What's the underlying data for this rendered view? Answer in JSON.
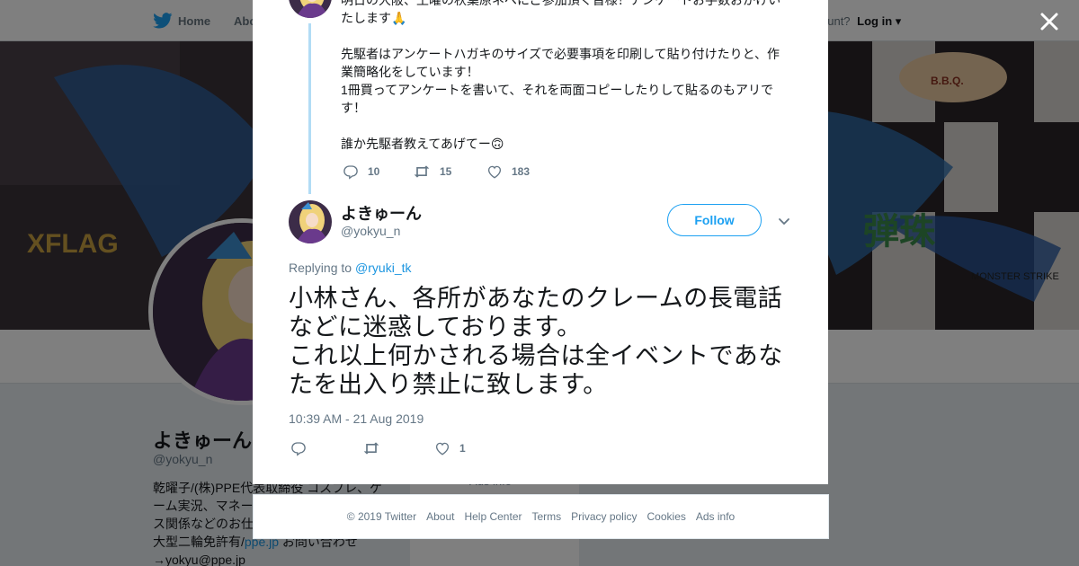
{
  "nav": {
    "home_label": "Home",
    "about_label": "Abo",
    "account_prompt": "ccount?",
    "login_label": "Log in"
  },
  "profile": {
    "name": "よきゅーん",
    "handle": "@yokyu_n",
    "bio_line1": "乾曜子/(株)PPE代表取締役 コスプレ、ゲ",
    "bio_line2": "ーム実況、マネー",
    "bio_line3": "ス関係などのお仕",
    "bio_line4_prefix": "大型二輪免許有/",
    "bio_link": "ppe.jp",
    "bio_line4_suffix": " お問い合わせ",
    "bio_line5": "→yokyu@ppe.jp",
    "card_text": "Ads info"
  },
  "previous_tweet": {
    "text": "明日の大阪、土曜の秋葉原ネベにご参加頂く皆様！アンケートお手数おかけいたします🙏\n\n先駆者はアンケートハガキのサイズで必要事項を印刷して貼り付けたりと、作業簡略化をしています！\n1冊買ってアンケートを書いて、それを両面コピーしたりして貼るのもアリです！\n\n誰か先駆者教えてあげてー🙃",
    "replies": "10",
    "retweets": "15",
    "likes": "183"
  },
  "tweet": {
    "author_name": "よきゅーん",
    "author_handle": "@yokyu_n",
    "follow_label": "Follow",
    "replying_to_label": "Replying to",
    "replying_to_handle": "@ryuki_tk",
    "text": "小林さん、各所があなたのクレームの長電話などに迷惑しております。\nこれ以上何かされる場合は全イベントであなたを出入り禁止に致します。",
    "timestamp": "10:39 AM - 21 Aug 2019",
    "likes": "1"
  },
  "footer": {
    "copyright": "© 2019 Twitter",
    "about": "About",
    "help": "Help Center",
    "terms": "Terms",
    "privacy": "Privacy policy",
    "cookies": "Cookies",
    "ads": "Ads info"
  },
  "colors": {
    "twitter_blue": "#1da1f2",
    "link_blue": "#1b95e0",
    "thread_line": "#b2dcf5",
    "muted_text": "#657786"
  },
  "icons": [
    "twitter-bird-icon",
    "close-icon",
    "reply-icon",
    "retweet-icon",
    "heart-icon",
    "chevron-down-icon"
  ]
}
